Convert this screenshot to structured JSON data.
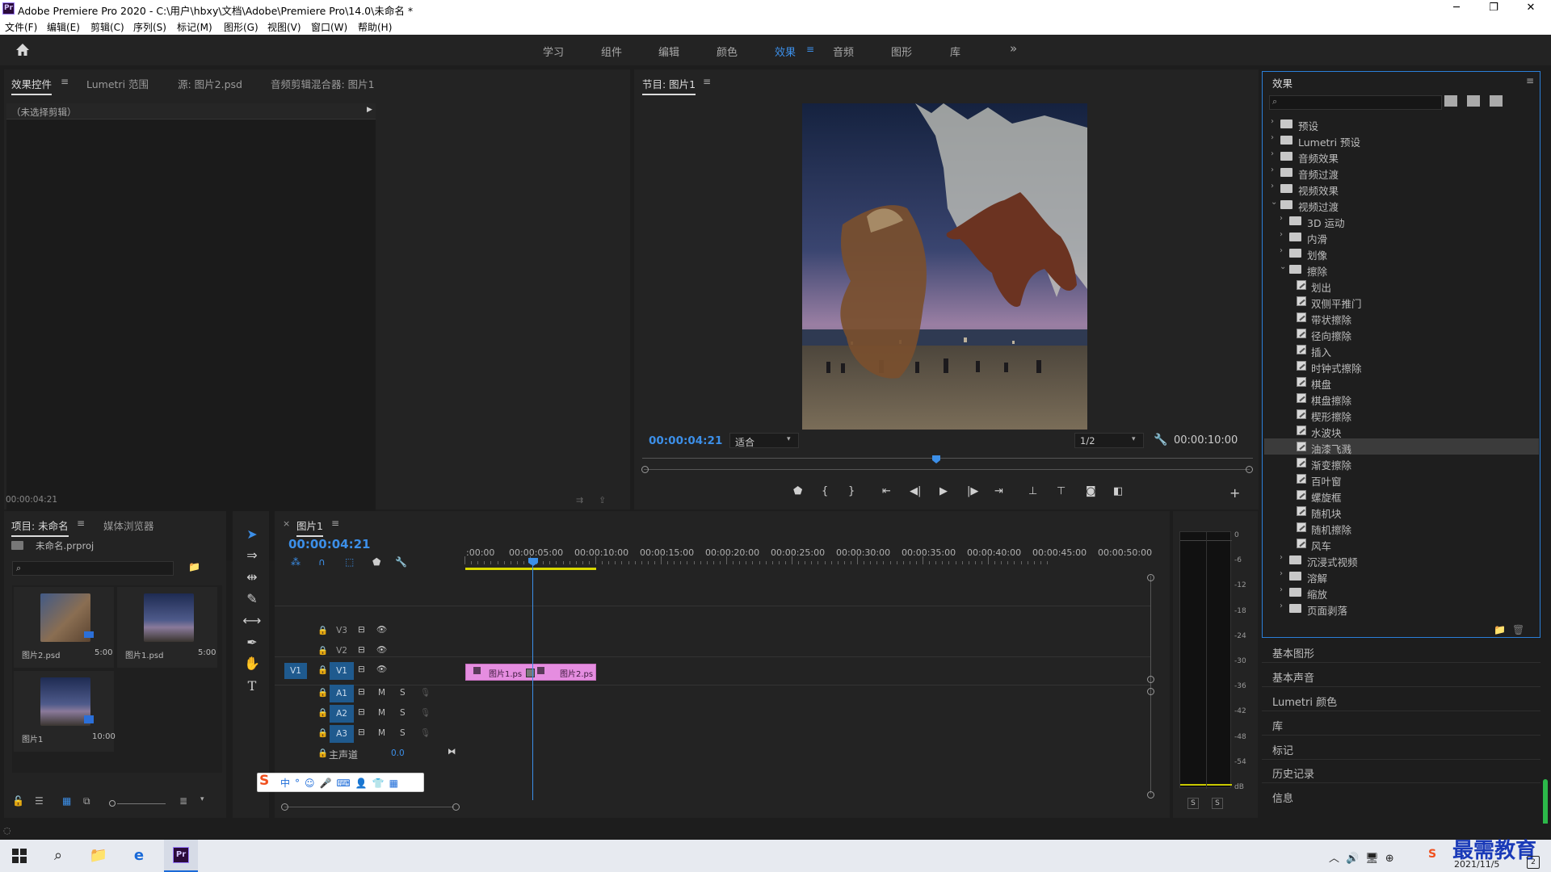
{
  "app": {
    "title": "Adobe Premiere Pro 2020 - C:\\用户\\hbxy\\文档\\Adobe\\Premiere Pro\\14.0\\未命名 *",
    "icon_text": "Pr"
  },
  "window_controls": {
    "minimize": "─",
    "maximize": "❐",
    "close": "✕"
  },
  "menu": [
    "文件(F)",
    "编辑(E)",
    "剪辑(C)",
    "序列(S)",
    "标记(M)",
    "图形(G)",
    "视图(V)",
    "窗口(W)",
    "帮助(H)"
  ],
  "workspaces": {
    "tabs": [
      "学习",
      "组件",
      "编辑",
      "颜色",
      "效果",
      "音频",
      "图形",
      "库"
    ],
    "active": "效果",
    "more": "»"
  },
  "source_panel": {
    "tabs": [
      "效果控件",
      "Lumetri 范围",
      "源: 图片2.psd",
      "音频剪辑混合器: 图片1"
    ],
    "no_clip": "（未选择剪辑）",
    "timecode": "00:00:04:21"
  },
  "program_monitor": {
    "title": "节目: 图片1",
    "timecode": "00:00:04:21",
    "fit": "适合",
    "resolution": "1/2",
    "duration": "00:00:10:00"
  },
  "project_panel": {
    "tabs": [
      "项目: 未命名",
      "媒体浏览器"
    ],
    "file": "未命名.prproj",
    "items": [
      {
        "name": "图片2.psd",
        "duration": "5:00"
      },
      {
        "name": "图片1.psd",
        "duration": "5:00"
      },
      {
        "name": "图片1",
        "duration": "10:00"
      }
    ]
  },
  "timeline": {
    "title": "图片1",
    "timecode": "00:00:04:21",
    "ruler": [
      ":00:00",
      "00:00:05:00",
      "00:00:10:00",
      "00:00:15:00",
      "00:00:20:00",
      "00:00:25:00",
      "00:00:30:00",
      "00:00:35:00",
      "00:00:40:00",
      "00:00:45:00",
      "00:00:50:00"
    ],
    "video_tracks": [
      "V3",
      "V2",
      "V1"
    ],
    "audio_tracks": [
      "A1",
      "A2",
      "A3"
    ],
    "source_patch": "V1",
    "master": {
      "label": "主声道",
      "value": "0.0"
    },
    "track_buttons": {
      "mute": "M",
      "solo": "S"
    },
    "clips": [
      {
        "name": "图片1.ps"
      },
      {
        "name": "图片2.ps"
      }
    ]
  },
  "audio_meter": {
    "scale": [
      "0",
      "-6",
      "-12",
      "-18",
      "-24",
      "-30",
      "-36",
      "-42",
      "-48",
      "-54",
      "dB"
    ],
    "solo": [
      "S",
      "S"
    ]
  },
  "effects_panel": {
    "title": "效果",
    "tree": [
      {
        "label": "预设",
        "type": "folder",
        "level": 0,
        "open": false
      },
      {
        "label": "Lumetri 预设",
        "type": "folder",
        "level": 0,
        "open": false
      },
      {
        "label": "音频效果",
        "type": "folder",
        "level": 0,
        "open": false
      },
      {
        "label": "音频过渡",
        "type": "folder",
        "level": 0,
        "open": false
      },
      {
        "label": "视频效果",
        "type": "folder",
        "level": 0,
        "open": false
      },
      {
        "label": "视频过渡",
        "type": "folder",
        "level": 0,
        "open": true
      },
      {
        "label": "3D 运动",
        "type": "folder",
        "level": 1,
        "open": false
      },
      {
        "label": "内滑",
        "type": "folder",
        "level": 1,
        "open": false
      },
      {
        "label": "划像",
        "type": "folder",
        "level": 1,
        "open": false
      },
      {
        "label": "擦除",
        "type": "folder",
        "level": 1,
        "open": true
      },
      {
        "label": "划出",
        "type": "fx",
        "level": 2
      },
      {
        "label": "双侧平推门",
        "type": "fx",
        "level": 2
      },
      {
        "label": "带状擦除",
        "type": "fx",
        "level": 2
      },
      {
        "label": "径向擦除",
        "type": "fx",
        "level": 2
      },
      {
        "label": "插入",
        "type": "fx",
        "level": 2
      },
      {
        "label": "时钟式擦除",
        "type": "fx",
        "level": 2
      },
      {
        "label": "棋盘",
        "type": "fx",
        "level": 2
      },
      {
        "label": "棋盘擦除",
        "type": "fx",
        "level": 2
      },
      {
        "label": "楔形擦除",
        "type": "fx",
        "level": 2
      },
      {
        "label": "水波块",
        "type": "fx",
        "level": 2
      },
      {
        "label": "油漆飞溅",
        "type": "fx",
        "level": 2,
        "selected": true
      },
      {
        "label": "渐变擦除",
        "type": "fx",
        "level": 2
      },
      {
        "label": "百叶窗",
        "type": "fx",
        "level": 2
      },
      {
        "label": "螺旋框",
        "type": "fx",
        "level": 2
      },
      {
        "label": "随机块",
        "type": "fx",
        "level": 2
      },
      {
        "label": "随机擦除",
        "type": "fx",
        "level": 2
      },
      {
        "label": "风车",
        "type": "fx",
        "level": 2
      },
      {
        "label": "沉浸式视频",
        "type": "folder",
        "level": 1,
        "open": false
      },
      {
        "label": "溶解",
        "type": "folder",
        "level": 1,
        "open": false
      },
      {
        "label": "缩放",
        "type": "folder",
        "level": 1,
        "open": false
      },
      {
        "label": "页面剥落",
        "type": "folder",
        "level": 1,
        "open": false
      }
    ]
  },
  "side_panels": [
    "基本图形",
    "基本声音",
    "Lumetri 颜色",
    "库",
    "标记",
    "历史记录",
    "信息"
  ],
  "taskbar": {
    "date": "2021/11/5",
    "watermark": "最需教育",
    "notification_count": "2"
  },
  "colors": {
    "accent": "#3c8fe8",
    "clip": "#e58de0",
    "in_out": "#d8d800",
    "panel": "#232323"
  }
}
